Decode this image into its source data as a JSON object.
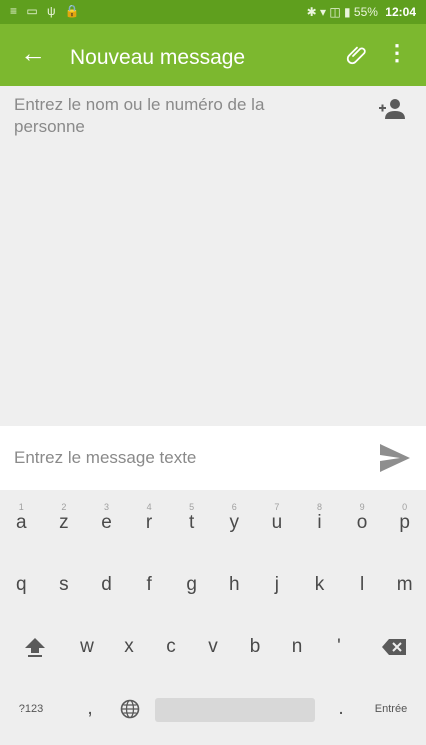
{
  "status_bar": {
    "left_icons": "≡ ▭ ψ 🔒",
    "right_icons": "✱ ▾ ◫ ▮ 55%",
    "time": "12:04"
  },
  "app_bar": {
    "back_icon": "arrow-left",
    "title": "Nouveau message",
    "attach_icon": "paperclip",
    "more_icon": "more-vertical"
  },
  "recipient": {
    "placeholder": "Entrez le nom ou le numéro de la personne",
    "add_contact_icon": "add-contact"
  },
  "compose": {
    "placeholder": "Entrez le message texte",
    "send_icon": "send"
  },
  "keyboard": {
    "row1": [
      {
        "label": "a",
        "hint": "1"
      },
      {
        "label": "z",
        "hint": "2"
      },
      {
        "label": "e",
        "hint": "3"
      },
      {
        "label": "r",
        "hint": "4"
      },
      {
        "label": "t",
        "hint": "5"
      },
      {
        "label": "y",
        "hint": "6"
      },
      {
        "label": "u",
        "hint": "7"
      },
      {
        "label": "i",
        "hint": "8"
      },
      {
        "label": "o",
        "hint": "9"
      },
      {
        "label": "p",
        "hint": "0"
      }
    ],
    "row2": [
      "q",
      "s",
      "d",
      "f",
      "g",
      "h",
      "j",
      "k",
      "l",
      "m"
    ],
    "row3": [
      "w",
      "x",
      "c",
      "v",
      "b",
      "n",
      "'"
    ],
    "shift_icon": "shift-arrow",
    "backspace_icon": "backspace",
    "symbols_label": "?123",
    "comma_label": ",",
    "emoji_icon": "globe",
    "period_label": ".",
    "enter_label": "Entrée"
  },
  "colors": {
    "appbar": "#7cb82f",
    "statusbar": "#5f9f1e"
  }
}
